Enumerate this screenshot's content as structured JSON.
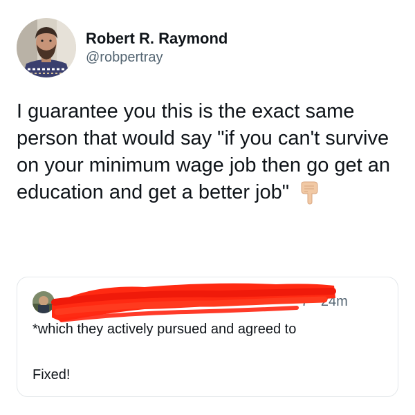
{
  "author": {
    "display_name": "Robert R. Raymond",
    "handle": "@robpertray"
  },
  "tweet": {
    "text": "I guarantee you this is the exact same person that would say \"if you can't survive on your minimum wage job then go get an education and get a better job\"",
    "emoji": "backhand-index-pointing-down"
  },
  "quote": {
    "time_suffix": "7 · 24m",
    "lines": [
      "*which they actively pursued and agreed to",
      "Fixed!"
    ]
  },
  "colors": {
    "text": "#0f1419",
    "secondary": "#536471",
    "border": "#e3e7ea",
    "redaction": "#ff2a12"
  }
}
